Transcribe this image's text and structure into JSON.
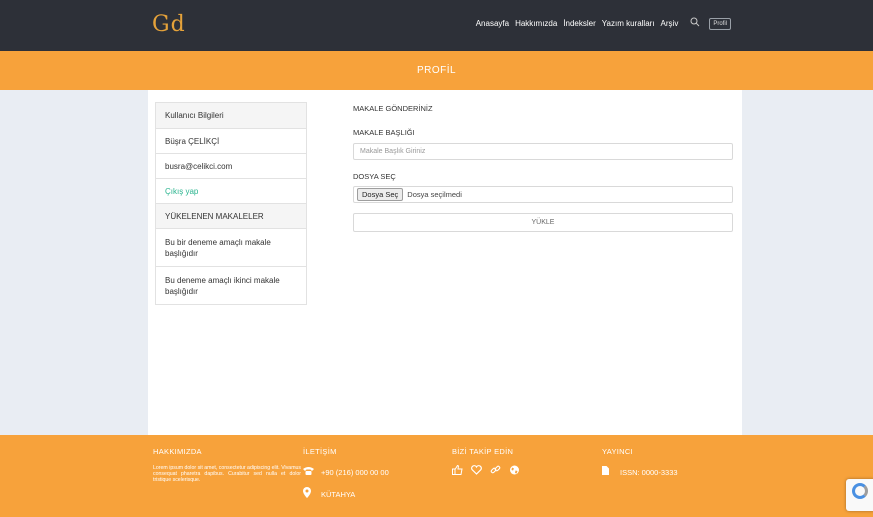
{
  "header": {
    "logo_text": "Gd",
    "nav": [
      "Anasayfa",
      "Hakkımızda",
      "İndeksler",
      "Yazım kuralları",
      "Arşiv"
    ],
    "search_icon": "search-icon",
    "profile_button": "Profil"
  },
  "banner": {
    "title": "PROFİL"
  },
  "sidebar": {
    "items": [
      {
        "label": "Kullanıcı Bilgileri",
        "kind": "header"
      },
      {
        "label": "Büşra ÇELİKÇİ",
        "kind": "text"
      },
      {
        "label": "busra@celikci.com",
        "kind": "text"
      },
      {
        "label": "Çıkış yap",
        "kind": "link"
      },
      {
        "label": "YÜKELENEN MAKALELER",
        "kind": "header"
      },
      {
        "label": "Bu bir deneme amaçlı makale başlığıdır",
        "kind": "text"
      },
      {
        "label": "Bu deneme amaçlı ikinci makale başlığıdır",
        "kind": "text"
      }
    ]
  },
  "form": {
    "heading": "MAKALE GÖNDERİNİZ",
    "title_label": "MAKALE BAŞLIĞI",
    "title_placeholder": "Makale Başlık Giriniz",
    "file_label": "DOSYA SEÇ",
    "file_button": "Dosya Seç",
    "file_status": "Dosya seçilmedi",
    "submit_label": "YÜKLE"
  },
  "footer": {
    "about": {
      "title": "HAKKIMIZDA",
      "text": "Lorem ipsum dolor sit amet, consectetur adipiscing elit. Vivamus consequat pharetra dapibus. Curabitur sed nulla et dolor tristique scelerisque."
    },
    "contact": {
      "title": "İLETİŞİM",
      "phone": "+90 (216) 000 00 00",
      "location": "KÜTAHYA"
    },
    "follow": {
      "title": "BİZİ TAKİP EDİN",
      "icons": [
        "thumbs-up-icon",
        "heart-icon",
        "link-icon",
        "globe-icon"
      ]
    },
    "publisher": {
      "title": "YAYINCI",
      "issn": "ISSN: 0000-3333"
    }
  },
  "colors": {
    "topbar": "#2d3038",
    "accent": "#f7a23b",
    "logo": "#e5a23a",
    "link": "#2bb48f"
  }
}
